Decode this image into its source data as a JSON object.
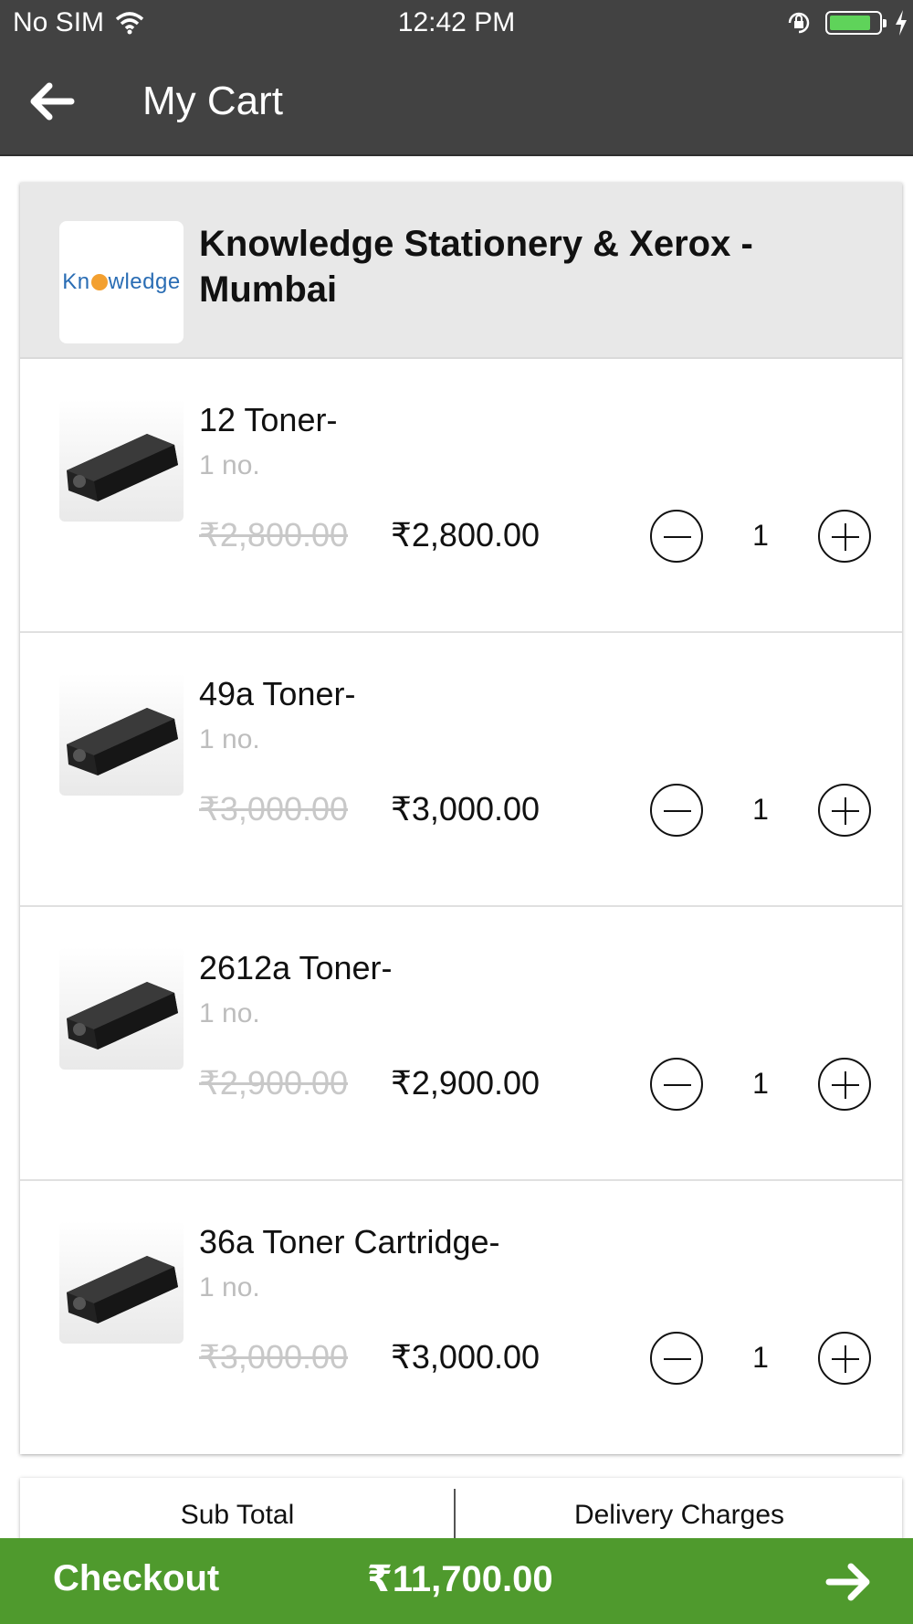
{
  "status_bar": {
    "carrier": "No SIM",
    "time": "12:42 PM",
    "battery_level": 0.85
  },
  "header": {
    "title": "My Cart"
  },
  "store": {
    "logo_text_left": "Kn",
    "logo_text_right": "wledge",
    "name": "Knowledge Stationery & Xerox - Mumbai"
  },
  "items": [
    {
      "name": "12 Toner-",
      "unit": "1 no.",
      "mrp": "₹2,800.00",
      "price": "₹2,800.00",
      "qty": "1"
    },
    {
      "name": "49a Toner-",
      "unit": "1 no.",
      "mrp": "₹3,000.00",
      "price": "₹3,000.00",
      "qty": "1"
    },
    {
      "name": "2612a Toner-",
      "unit": "1 no.",
      "mrp": "₹2,900.00",
      "price": "₹2,900.00",
      "qty": "1"
    },
    {
      "name": "36a Toner Cartridge-",
      "unit": "1 no.",
      "mrp": "₹3,000.00",
      "price": "₹3,000.00",
      "qty": "1"
    }
  ],
  "summary": {
    "subtotal_label": "Sub Total",
    "delivery_label": "Delivery Charges"
  },
  "checkout": {
    "label": "Checkout",
    "total": "₹11,700.00"
  },
  "icons": {
    "back": "back-arrow-icon",
    "checkout": "forward-arrow-icon",
    "wifi": "wifi-icon",
    "lock": "rotation-lock-icon",
    "battery": "battery-icon",
    "charging": "charging-bolt-icon"
  },
  "colors": {
    "header": "#424242",
    "checkout": "#4f9a2d",
    "store_band": "#e8e8e8",
    "strike": "#c8c8c8"
  }
}
